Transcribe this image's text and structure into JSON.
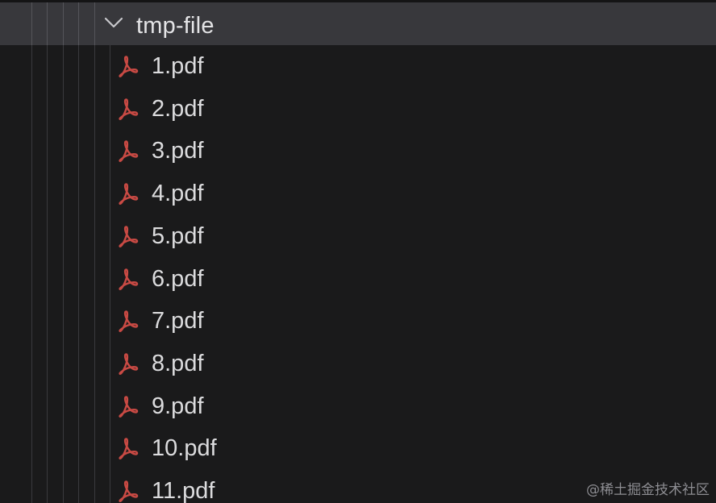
{
  "folder": {
    "name": "tmp-file",
    "expanded": true,
    "chevron_icon": "chevron-down-icon"
  },
  "files": [
    {
      "name": "1.pdf",
      "icon": "pdf-icon"
    },
    {
      "name": "2.pdf",
      "icon": "pdf-icon"
    },
    {
      "name": "3.pdf",
      "icon": "pdf-icon"
    },
    {
      "name": "4.pdf",
      "icon": "pdf-icon"
    },
    {
      "name": "5.pdf",
      "icon": "pdf-icon"
    },
    {
      "name": "6.pdf",
      "icon": "pdf-icon"
    },
    {
      "name": "7.pdf",
      "icon": "pdf-icon"
    },
    {
      "name": "8.pdf",
      "icon": "pdf-icon"
    },
    {
      "name": "9.pdf",
      "icon": "pdf-icon"
    },
    {
      "name": "10.pdf",
      "icon": "pdf-icon"
    },
    {
      "name": "11.pdf",
      "icon": "pdf-icon"
    }
  ],
  "watermark": "@稀土掘金技术社区",
  "colors": {
    "background": "#1a1a1b",
    "selected_row": "#38383c",
    "pdf_icon": "#c94a44",
    "text": "#dcdcde"
  }
}
